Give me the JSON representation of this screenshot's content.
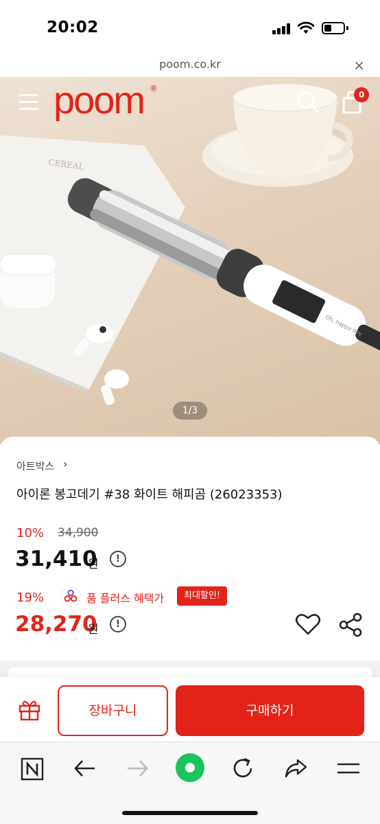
{
  "status_bar": {
    "time": "20:02"
  },
  "browser": {
    "url": "poom.co.kr",
    "close_glyph": "×"
  },
  "header": {
    "logo": "poom",
    "logo_mark": "®",
    "cart_count": "0"
  },
  "gallery": {
    "pager": "1/3"
  },
  "product": {
    "brand": "아트박스",
    "brand_chevron": "›",
    "title": "아이론 봉고데기 #38 화이트 해피곰 (26023353)",
    "discount_rate": "10%",
    "original_price": "34,900",
    "price": "31,410",
    "currency": "원",
    "plus_discount_rate": "19%",
    "plus_label": "품 플러스 혜택가",
    "max_discount_badge": "최대할인!",
    "plus_price": "28,270",
    "info_glyph": "!"
  },
  "actions": {
    "cart_label": "장바구니",
    "buy_label": "구매하기"
  },
  "icons": [
    "menu-icon",
    "search-icon",
    "cart-icon",
    "info-icon",
    "heart-icon",
    "share-icon",
    "gift-icon",
    "n-icon",
    "back-arrow-icon",
    "forward-arrow-icon",
    "green-dot-icon",
    "reload-icon",
    "share-arrow-icon",
    "menu-lines-icon"
  ],
  "colors": {
    "brand_red": "#e2231a",
    "green": "#19c45d"
  }
}
